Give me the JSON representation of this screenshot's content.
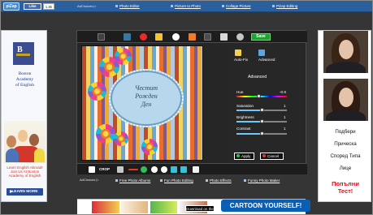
{
  "topbar": {
    "logo": "piZap",
    "like_label": "Like",
    "like_count": "1.8k",
    "adchoices": "AdChoices ▷",
    "links": [
      {
        "label": "Photo Editor"
      },
      {
        "label": "Picture to Photo"
      },
      {
        "label": "Collage Picture"
      },
      {
        "label": "Pizap Editing"
      }
    ]
  },
  "left_ad": {
    "logo_letters": "B",
    "title_line_1": "Boston",
    "title_line_2": "Academy",
    "title_line_3": "of English",
    "caption_line_1": "Learn English Abroad!",
    "caption_line_2": "Join Us At Boston",
    "caption_line_3": "Academy of English",
    "button_label": "LEARN MORE"
  },
  "editor": {
    "save_label": "Save",
    "photo_text_line_1": "Честит",
    "photo_text_line_2": "Рожден",
    "photo_text_line_3": "Ден",
    "bottom_tool_crop": "CROP",
    "panel": {
      "auto_fix": "Auto-Fix",
      "advanced_tab": "Advanced",
      "section_title": "Advanced",
      "hue_label": "Hue",
      "hue_value": "-0.8",
      "saturation_label": "Saturation",
      "saturation_value": "1",
      "brightness_label": "Brightness",
      "brightness_value": "1",
      "contrast_label": "Contrast",
      "contrast_value": "1",
      "apply_label": "Apply",
      "cancel_label": "Cancel"
    }
  },
  "right_ad": {
    "line_1": "Подбери",
    "line_2": "Прическа",
    "line_3": "Според Типа",
    "line_4": "Лице",
    "red_line_1": "Попълни",
    "red_line_2": "Тест!"
  },
  "bottom_links": {
    "adchoices": "AdChoices ▷",
    "links": [
      {
        "label": "Free Photo Albums"
      },
      {
        "label": "Fun Photo Editing"
      },
      {
        "label": "Photo Effects"
      },
      {
        "label": "Funny Photo Maker"
      }
    ]
  },
  "bottom_ad": {
    "app_label": "Download on the",
    "cartoon_label": "CARTOON YOURSELF!"
  }
}
